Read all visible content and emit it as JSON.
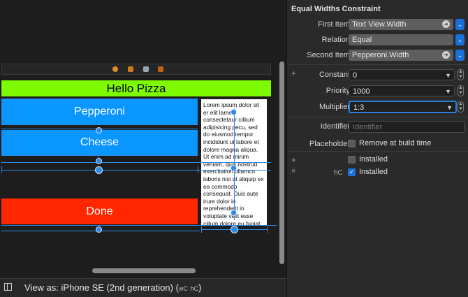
{
  "canvas": {
    "title": "Hello Pizza",
    "buttons": {
      "pepperoni": "Pepperoni",
      "cheese": "Cheese",
      "done": "Done"
    },
    "text_view": "Lorem ipsum dolor sit er elit lamet, consectetaur cillium adipisicing pecu, sed do eiusmod tempor incididunt ut labore et dolore magna aliqua. Ut enim ad minim veniam, quis nostrud exercitation ullamco laboris nisi ut aliquip ex ea commodo consequat. Duis aute irure dolor in reprehenderit in voluptate velit esse cillum dolore eu fugiat nulla pariatur.",
    "colors": {
      "title_bg": "#7efb00",
      "button_bg": "#0996ff",
      "done_bg": "#ff2600",
      "constraint": "#2f8ae5"
    }
  },
  "bottom_bar": {
    "view_as_label": "View as: iPhone SE (2nd generation) (",
    "wc": "wC",
    "hc": "hC",
    "close_paren": ")"
  },
  "inspector": {
    "title": "Equal Widths Constraint",
    "first_item": {
      "label": "First Item",
      "value": "Text View.Width"
    },
    "relation": {
      "label": "Relation",
      "value": "Equal"
    },
    "second_item": {
      "label": "Second Item",
      "value": "Pepperoni.Width"
    },
    "constant": {
      "label": "Constant",
      "value": "0"
    },
    "priority": {
      "label": "Priority",
      "value": "1000"
    },
    "multiplier": {
      "label": "Multiplier",
      "value": "1:3"
    },
    "identifier": {
      "label": "Identifier",
      "placeholder": "Identifier"
    },
    "placeholder": {
      "label": "Placeholder",
      "checkbox_label": "Remove at build time"
    },
    "installed_1": {
      "checkbox_label": "Installed"
    },
    "installed_2": {
      "trait": "hC",
      "checkbox_label": "Installed"
    }
  }
}
